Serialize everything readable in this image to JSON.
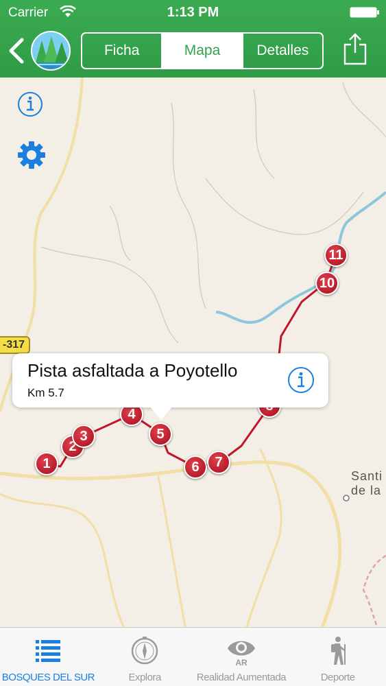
{
  "status_bar": {
    "carrier": "Carrier",
    "time": "1:13 PM"
  },
  "header": {
    "segments": [
      {
        "label": "Ficha",
        "active": false
      },
      {
        "label": "Mapa",
        "active": true
      },
      {
        "label": "Detalles",
        "active": false
      }
    ]
  },
  "map": {
    "road_label": "-317",
    "town_label": "Santi de la",
    "markers": [
      "1",
      "2",
      "3",
      "4",
      "5",
      "6",
      "7",
      "8",
      "10",
      "11"
    ],
    "route_color": "#c0152a"
  },
  "callout": {
    "title": "Pista asfaltada a Poyotello",
    "subtitle": "Km 5.7"
  },
  "tabbar": {
    "tabs": [
      {
        "label": "BOSQUES DEL SUR",
        "icon": "list-icon",
        "active": true
      },
      {
        "label": "Explora",
        "icon": "compass-icon",
        "active": false
      },
      {
        "label": "Realidad Aumentada",
        "icon": "ar-eye-icon",
        "active": false
      },
      {
        "label": "Deporte",
        "icon": "hiker-icon",
        "active": false
      }
    ]
  },
  "colors": {
    "header_green": "#33a24a",
    "accent_blue": "#1a7fe0",
    "marker_red": "#c0152a"
  }
}
